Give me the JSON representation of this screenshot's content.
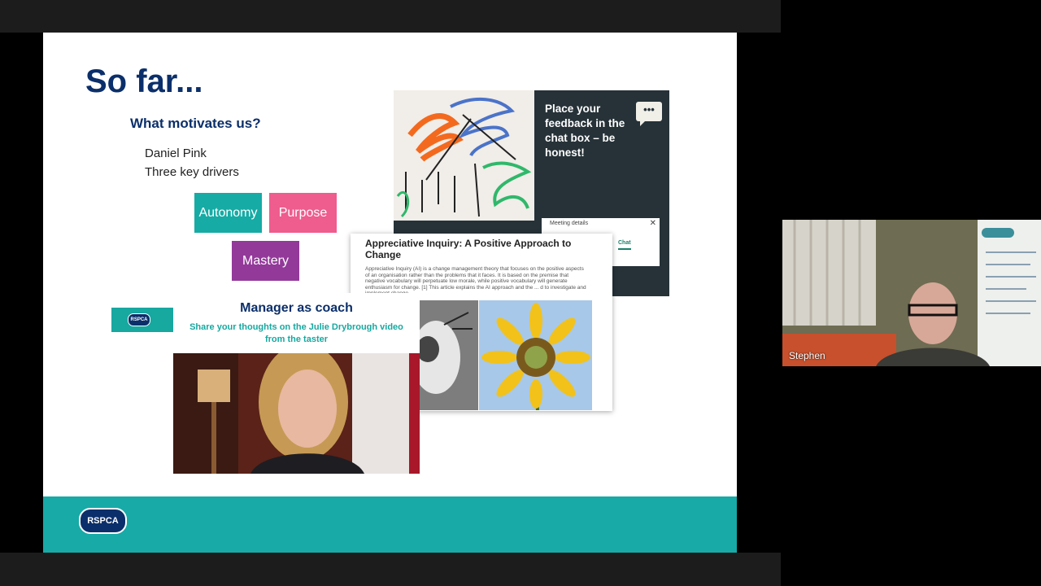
{
  "slide": {
    "title": "So far...",
    "subheading": "What motivates us?",
    "lines": [
      "Daniel Pink",
      "Three key drivers"
    ],
    "drivers": {
      "autonomy": "Autonomy",
      "purpose": "Purpose",
      "mastery": "Mastery"
    }
  },
  "chat_card": {
    "text": "Place your feedback in the chat box – be honest!",
    "dots": "•••",
    "meeting_label": "Meeting details",
    "close": "✕",
    "chat_tab": "Chat"
  },
  "article": {
    "title": "Appreciative Inquiry: A Positive Approach to Change",
    "body": "Appreciative Inquiry (AI) is a change management theory that focuses on the positive aspects of an organisation rather than the problems that it faces. It is based on the premise that negative vocabulary will perpetuate low morale, while positive vocabulary will generate enthusiasm for change. [1] This article explains the AI approach and the ... d to investigate and implement change."
  },
  "coach": {
    "logo": "RSPCA",
    "title": "Manager as coach",
    "subtitle": "Share your thoughts on the Julie Drybrough video from the taster"
  },
  "footer": {
    "logo": "RSPCA"
  },
  "participant": {
    "name": "Stephen"
  },
  "colors": {
    "navy": "#0b2f6a",
    "teal": "#17aaa7",
    "pink": "#ef5c8e",
    "purple": "#93399a",
    "chat_bg": "#263238"
  }
}
